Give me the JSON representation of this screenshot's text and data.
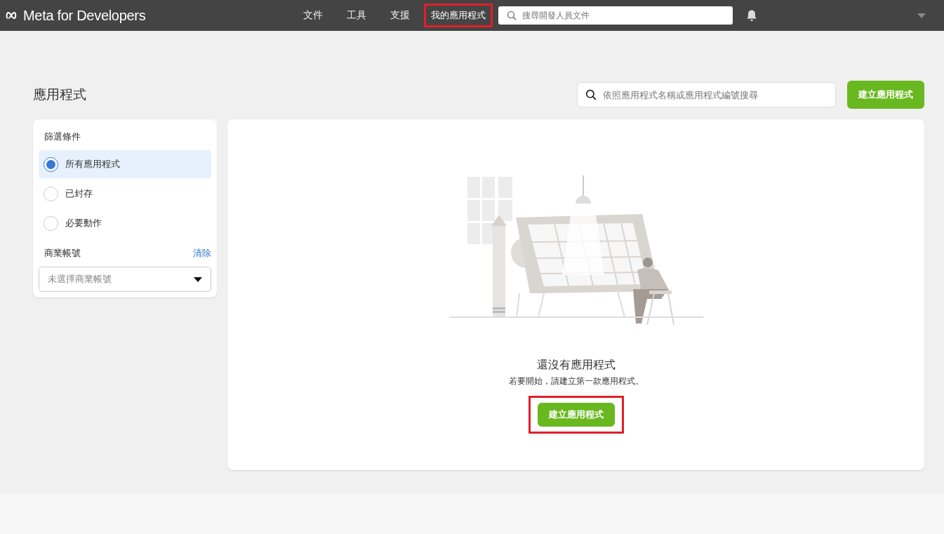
{
  "navbar": {
    "logo": "Meta for Developers",
    "links": [
      {
        "label": "文件",
        "selected": false,
        "highlighted": false
      },
      {
        "label": "工具",
        "selected": false,
        "highlighted": false
      },
      {
        "label": "支援",
        "selected": false,
        "highlighted": false
      },
      {
        "label": "我的應用程式",
        "selected": true,
        "highlighted": true
      }
    ],
    "search": {
      "placeholder": "搜尋開發人員文件"
    }
  },
  "page": {
    "title": "應用程式",
    "search": {
      "placeholder": "依照應用程式名稱或應用程式編號搜尋"
    },
    "create_button": "建立應用程式"
  },
  "filters": {
    "title": "篩選條件",
    "options": [
      {
        "label": "所有應用程式",
        "selected": true
      },
      {
        "label": "已封存",
        "selected": false
      },
      {
        "label": "必要動作",
        "selected": false
      }
    ],
    "business": {
      "label": "商業帳號",
      "clear": "清除",
      "dropdown": {
        "placeholder": "未選擇商業帳號"
      }
    }
  },
  "empty_state": {
    "title": "還沒有應用程式",
    "subtitle": "若要開始，請建立第一款應用程式。",
    "button": "建立應用程式",
    "highlighted": true
  }
}
